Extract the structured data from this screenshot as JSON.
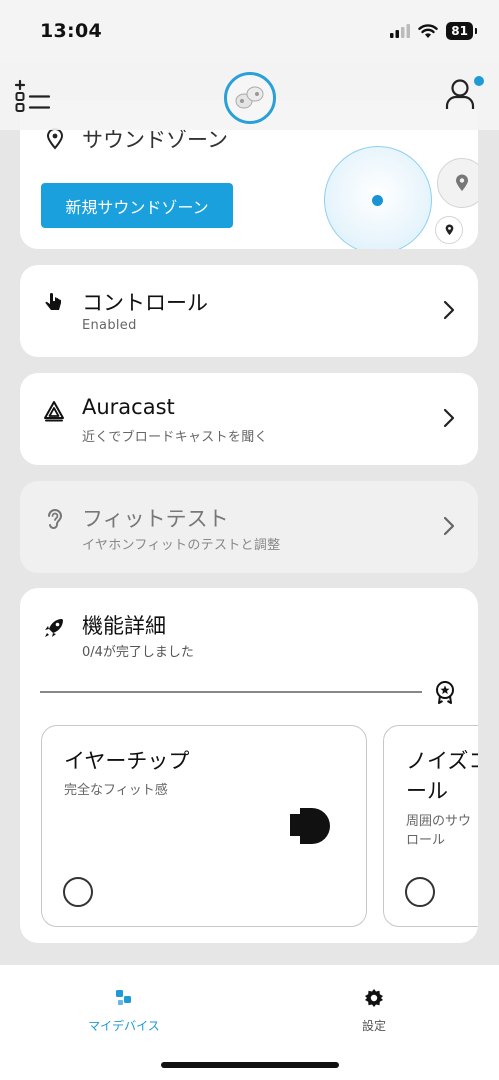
{
  "status_bar": {
    "time": "13:04",
    "battery": "81",
    "signal_icon": "cellular-signal-icon",
    "wifi_icon": "wifi-icon"
  },
  "header": {
    "menu_icon": "list-menu-icon",
    "logo_icon": "earbuds-device-icon",
    "account_icon": "user-account-icon",
    "notification_color": "#1e9ad6"
  },
  "sound_zone": {
    "title": "サウンドゾーン",
    "new_zone_button": "新規サウンドゾーン",
    "pin_icon": "location-pin-icon"
  },
  "rows": [
    {
      "id": "control",
      "title": "コントロール",
      "subtitle": "Enabled",
      "icon": "touch-gesture-icon"
    },
    {
      "id": "auracast",
      "title": "Auracast",
      "subtitle": "近くでブロードキャストを聞く",
      "icon": "auracast-icon"
    },
    {
      "id": "fit-test",
      "title": "フィットテスト",
      "subtitle": "イヤホンフィットのテストと調整",
      "icon": "ear-icon"
    }
  ],
  "features": {
    "title": "機能詳細",
    "progress_text": "0/4が完了しました",
    "progress": 0,
    "tiles": [
      {
        "title": "イヤーチップ",
        "subtitle": "完全なフィット感"
      },
      {
        "title": "ノイズコントロール",
        "title_visible": "ノイズコ\nール",
        "subtitle": "周囲のサウ\nロール"
      }
    ]
  },
  "tabs": [
    {
      "label": "マイデバイス",
      "icon": "my-device-icon",
      "active": true
    },
    {
      "label": "設定",
      "icon": "settings-gear-icon",
      "active": false
    }
  ],
  "colors": {
    "accent": "#1aa0dd",
    "background": "#e6e6e6"
  }
}
